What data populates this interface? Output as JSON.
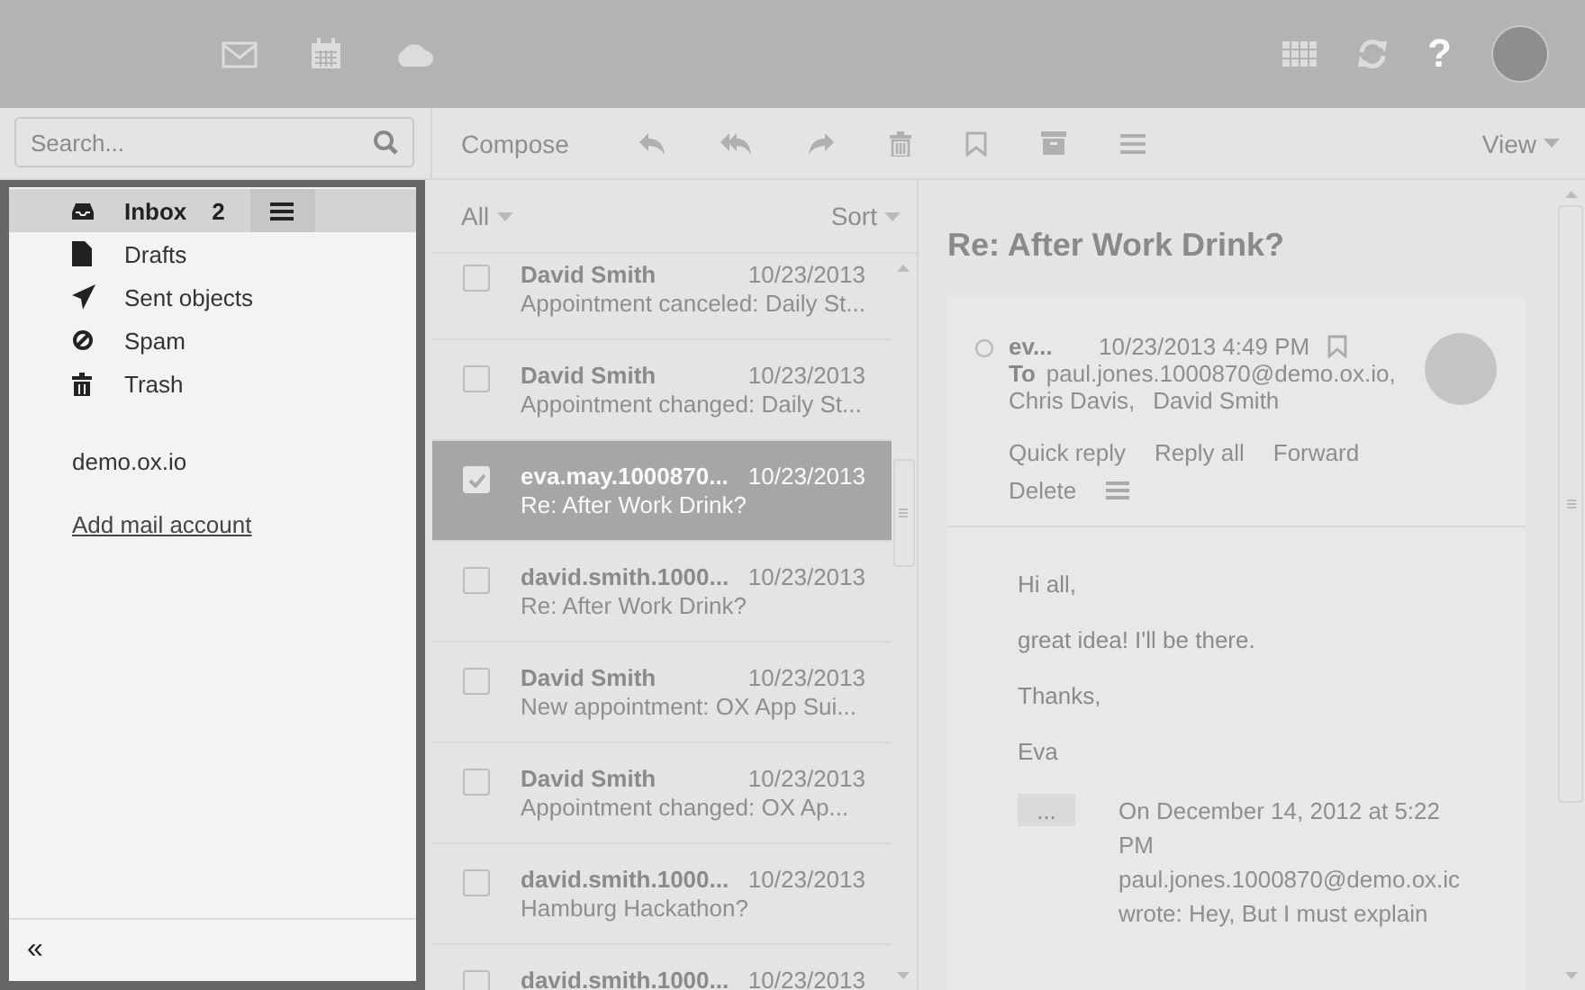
{
  "top_bar": {
    "help": "?"
  },
  "search": {
    "placeholder": "Search..."
  },
  "toolbar": {
    "compose": "Compose",
    "view": "View"
  },
  "folders": [
    {
      "label": "Inbox",
      "count": "2",
      "selected": true,
      "kind": "inbox"
    },
    {
      "label": "Drafts",
      "selected": false,
      "kind": "drafts"
    },
    {
      "label": "Sent objects",
      "selected": false,
      "kind": "sent"
    },
    {
      "label": "Spam",
      "selected": false,
      "kind": "spam"
    },
    {
      "label": "Trash",
      "selected": false,
      "kind": "trash"
    }
  ],
  "account": "demo.ox.io",
  "add_account": "Add mail account",
  "collapse": "«",
  "list": {
    "filter": "All",
    "sort": "Sort"
  },
  "messages": [
    {
      "from": "David Smith",
      "date": "10/23/2013",
      "subject": "Appointment canceled: Daily St...",
      "selected": false
    },
    {
      "from": "David Smith",
      "date": "10/23/2013",
      "subject": "Appointment changed: Daily St...",
      "selected": false
    },
    {
      "from": "eva.may.1000870...",
      "date": "10/23/2013",
      "subject": "Re: After Work Drink?",
      "selected": true
    },
    {
      "from": "david.smith.1000...",
      "date": "10/23/2013",
      "subject": "Re: After Work Drink?",
      "selected": false
    },
    {
      "from": "David Smith",
      "date": "10/23/2013",
      "subject": "New appointment: OX App Sui...",
      "selected": false
    },
    {
      "from": "David Smith",
      "date": "10/23/2013",
      "subject": "Appointment changed: OX Ap...",
      "selected": false
    },
    {
      "from": "david.smith.1000...",
      "date": "10/23/2013",
      "subject": "Hamburg Hackathon?",
      "selected": false
    },
    {
      "from": "david.smith.1000...",
      "date": "10/23/2013",
      "selected": false
    }
  ],
  "reading": {
    "subject": "Re: After Work Drink?",
    "from": "ev...",
    "date": "10/23/2013 4:49 PM",
    "to_label": "To",
    "recipients": [
      "paul.jones.1000870@demo.ox.io,",
      "Chris Davis,",
      "David Smith"
    ],
    "actions": [
      "Quick reply",
      "Reply all",
      "Forward",
      "Delete"
    ],
    "body": [
      "Hi all,",
      "great idea! I'll be there.",
      "Thanks,",
      "Eva"
    ],
    "quote_toggle": "...",
    "quote": "On December 14, 2012 at 5:22 PM paul.jones.1000870@demo.ox.ic wrote: Hey, But I must explain"
  }
}
